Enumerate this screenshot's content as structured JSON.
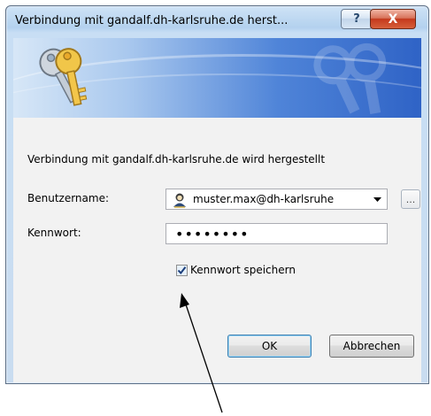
{
  "window": {
    "title": "Verbindung mit gandalf.dh-karlsruhe.de herst...",
    "help_label": "?",
    "close_label": "X"
  },
  "banner": {
    "icon": "keys-icon"
  },
  "dialog": {
    "connecting_text": "Verbindung mit gandalf.dh-karlsruhe.de wird hergestellt",
    "username_label": "Benutzername:",
    "username_value": "muster.max@dh-karlsruhe",
    "browse_label": "...",
    "password_label": "Kennwort:",
    "password_value": "••••••••",
    "save_password_label": "Kennwort speichern",
    "save_password_checked": true,
    "ok_label": "OK",
    "cancel_label": "Abbrechen"
  },
  "colors": {
    "banner_dark": "#2f63c6",
    "ok_focus_border": "#3c7fb1",
    "close_red": "#c4391c"
  }
}
